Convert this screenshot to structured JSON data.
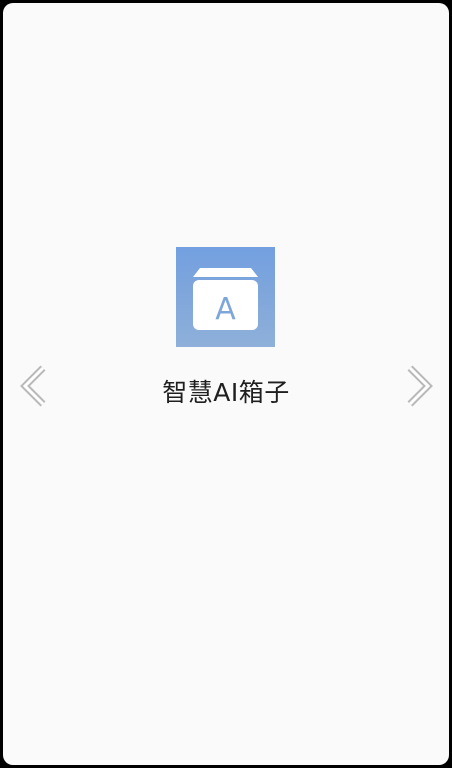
{
  "app": {
    "name": "智慧AI箱子",
    "logo_icon": "box-letter-a-icon",
    "logo_letter": "A",
    "logo_colors": {
      "gradient_top": "#73a0e1",
      "gradient_bottom": "#8eb0da",
      "glyph": "#ffffff"
    }
  },
  "navigation": {
    "prev_icon": "chevron-left-icon",
    "next_icon": "chevron-right-icon"
  },
  "theme": {
    "background": "#fafafa",
    "text": "#1f1f1f"
  }
}
